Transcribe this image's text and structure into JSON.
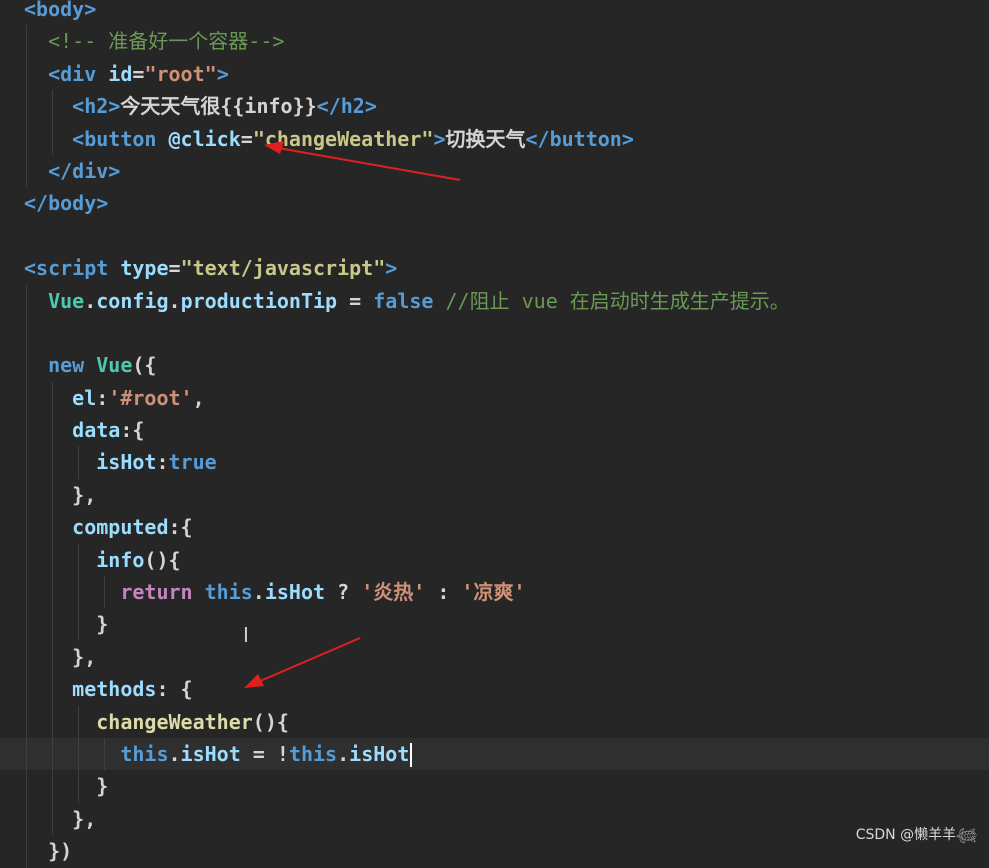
{
  "code": {
    "l0": "<body>",
    "comment_html": "<!-- 准备好一个容器-->",
    "div_open_tag": "<div",
    "div_id_attr": " id",
    "div_id_eq": "=",
    "div_id_val": "\"root\"",
    "div_open_end": ">",
    "h2_open": "<h2>",
    "h2_text": "今天天气很{{info}}",
    "h2_close": "</h2>",
    "btn_open": "<button",
    "btn_attr": " @click",
    "btn_eq": "=",
    "btn_val": "\"changeWeather\"",
    "btn_open_end": ">",
    "btn_text": "切换天气",
    "btn_close": "</button>",
    "div_close": "</div>",
    "body_close": "</body>",
    "script_open": "<script",
    "script_attr": " type",
    "script_eq": "=",
    "script_val": "\"text/javascript\"",
    "script_end": ">",
    "vue_cls": "Vue",
    "dot1": ".",
    "config": "config",
    "dot2": ".",
    "productionTip": "productionTip",
    "assign": " = ",
    "false_kw": "false",
    "js_comment": " //阻止 vue 在启动时生成生产提示。",
    "new_kw": "new",
    "new_vue": " Vue",
    "new_paren": "({",
    "el_key": "el",
    "el_colon": ":",
    "el_val": "'#root'",
    "el_comma": ",",
    "data_key": "data",
    "data_brace": ":{",
    "ishot_key": "isHot",
    "ishot_colon": ":",
    "ishot_val": "true",
    "close_brace_comma": "},",
    "computed_key": "computed",
    "computed_brace": ":{",
    "info_fn": "info",
    "info_paren": "(){",
    "return_kw": "return",
    "this1": " this",
    "dot3": ".",
    "ishot1": "isHot",
    "ternary_q": " ? ",
    "str_hot": "'炎热'",
    "ternary_c": " : ",
    "str_cool": "'凉爽'",
    "close_brace": "}",
    "close_brace_comma2": "},",
    "methods_key": "methods",
    "methods_brace": ": {",
    "change_fn": "changeWeather",
    "change_paren": "(){",
    "this2": "this",
    "dot4": ".",
    "ishot2": "isHot",
    "eq_not": " = !",
    "this3": "this",
    "dot5": ".",
    "ishot3": "isHot",
    "close_brace2": "}",
    "close_brace_comma3": "},",
    "end_paren": "})"
  },
  "watermark": "CSDN @懒羊羊𓆉",
  "colors": {
    "background": "#262626",
    "arrow": "#e02020"
  }
}
